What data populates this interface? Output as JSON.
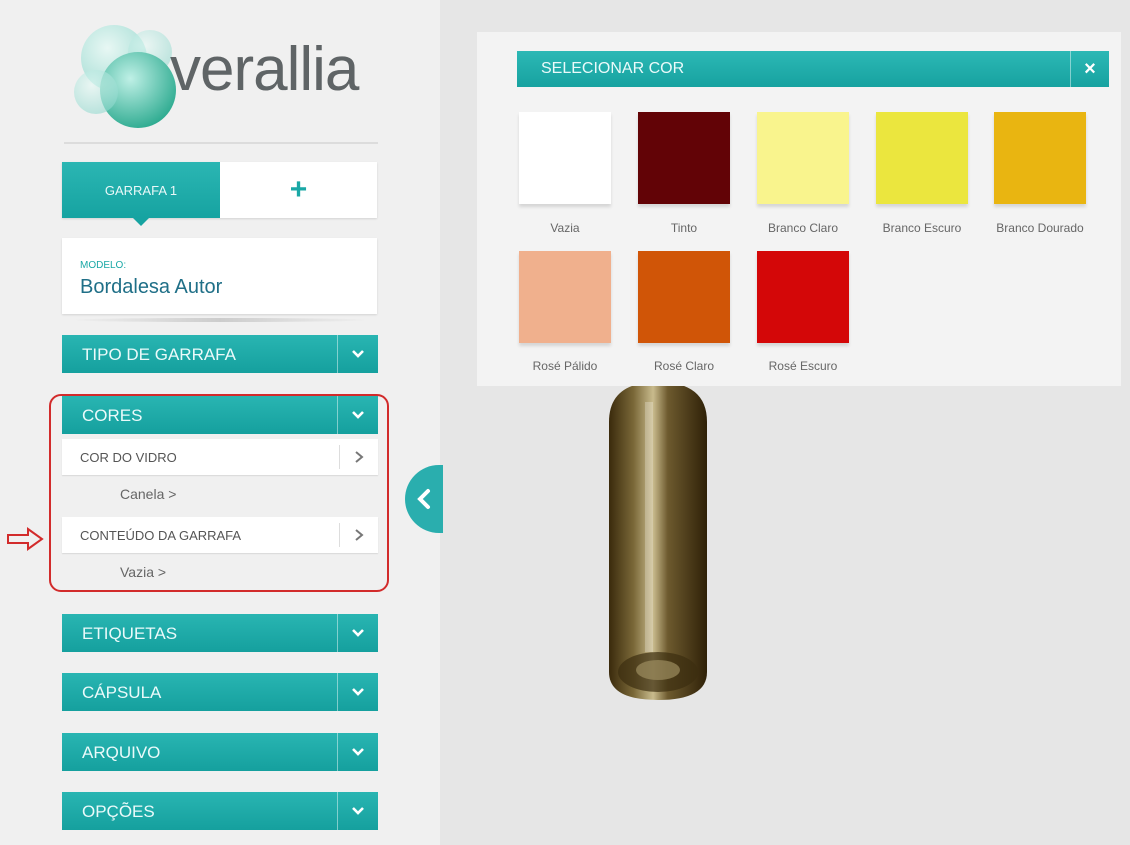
{
  "brand": {
    "name": "verallia"
  },
  "tabs": {
    "active_label": "GARRAFA 1",
    "add_label": "+"
  },
  "model": {
    "label": "MODELO:",
    "value": "Bordalesa Autor"
  },
  "sections": {
    "tipo": {
      "label": "TIPO DE GARRAFA"
    },
    "cores": {
      "label": "CORES",
      "cor_vidro": {
        "label": "COR DO VIDRO",
        "value": "Canela  >"
      },
      "conteudo": {
        "label": "CONTEÚDO DA GARRAFA",
        "value": "Vazia  >"
      }
    },
    "etiquetas": {
      "label": "ETIQUETAS"
    },
    "capsula": {
      "label": "CÁPSULA"
    },
    "arquivo": {
      "label": "ARQUIVO"
    },
    "opcoes": {
      "label": "OPÇÕES"
    }
  },
  "color_panel": {
    "title": "SELECIONAR COR",
    "close_label": "×",
    "colors": [
      {
        "name": "Vazia",
        "hex": "#ffffff"
      },
      {
        "name": "Tinto",
        "hex": "#620306"
      },
      {
        "name": "Branco Claro",
        "hex": "#f9f48d"
      },
      {
        "name": "Branco Escuro",
        "hex": "#ebe63e"
      },
      {
        "name": "Branco Dourado",
        "hex": "#e9b511"
      },
      {
        "name": "Rosé Pálido",
        "hex": "#f0b08d"
      },
      {
        "name": "Rosé Claro",
        "hex": "#d05507"
      },
      {
        "name": "Rosé Escuro",
        "hex": "#d40708"
      }
    ]
  },
  "theme": {
    "accent": "#1aa8a6",
    "highlight": "#d22b2b"
  }
}
